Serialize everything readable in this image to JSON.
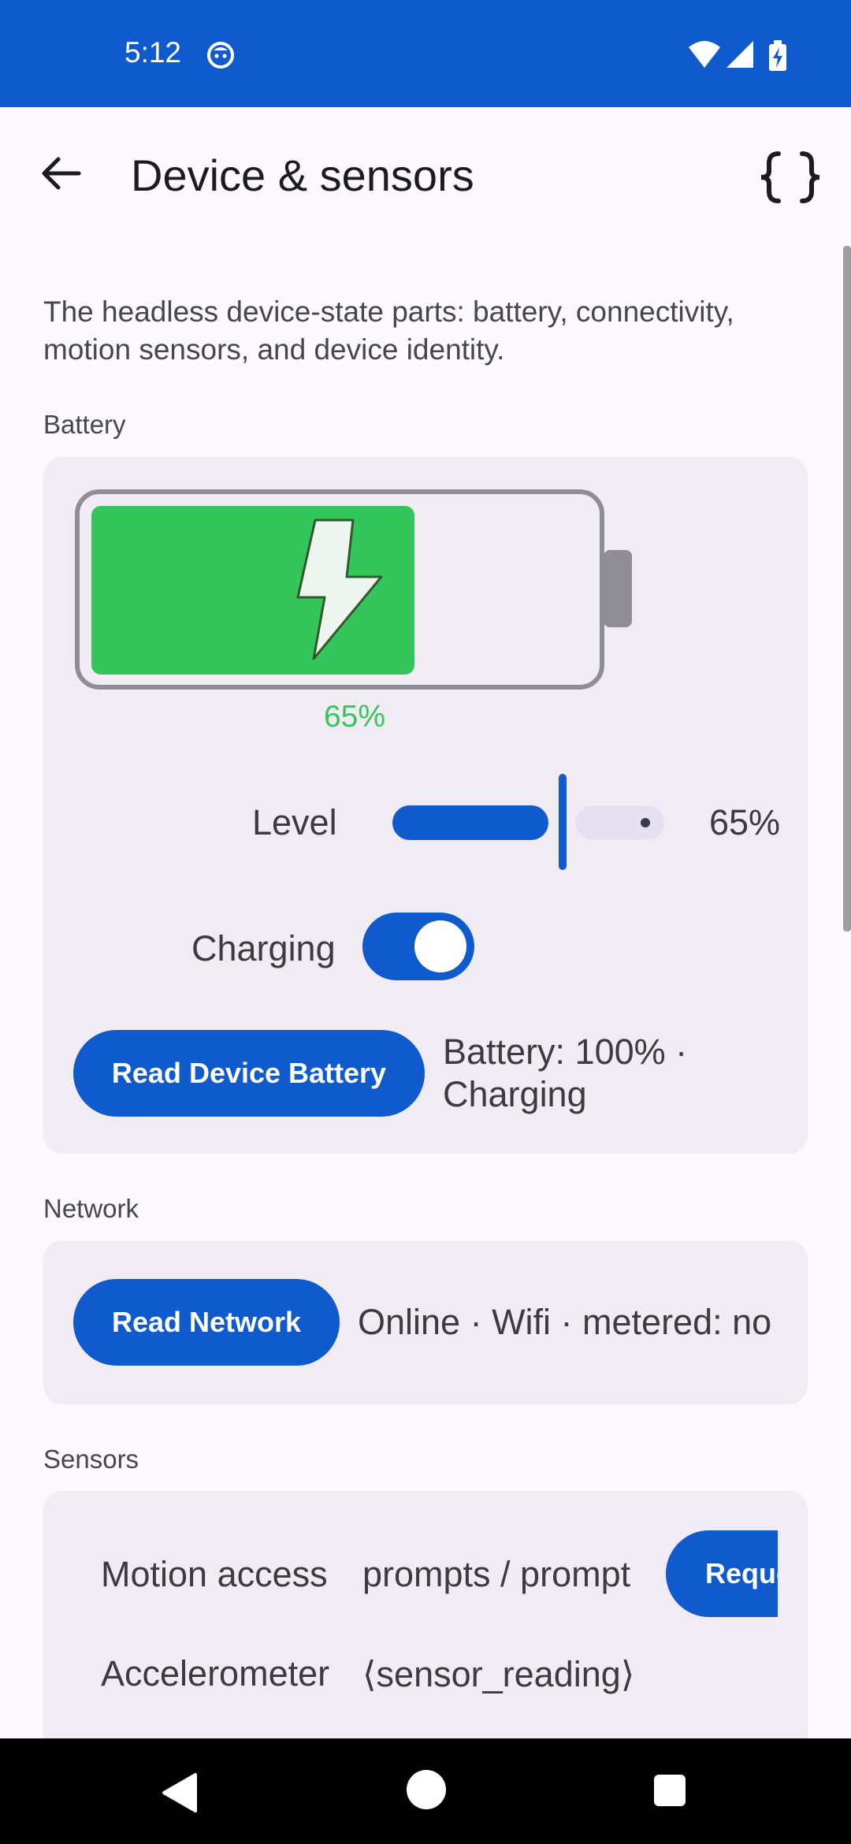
{
  "status_bar": {
    "time": "5:12"
  },
  "app_bar": {
    "title": "Device & sensors"
  },
  "description": "The headless device-state parts: battery, connectivity, motion sensors, and device identity.",
  "battery": {
    "section_label": "Battery",
    "level_percent": 65,
    "level_text": "65%",
    "level_label": "Level",
    "slider_value_text": "65%",
    "charging_label": "Charging",
    "charging_on": true,
    "read_button": "Read Device Battery",
    "result": "Battery: 100% · Charging",
    "fill_color": "#34c65a"
  },
  "network": {
    "section_label": "Network",
    "read_button": "Read Network",
    "result": "Online · Wifi · metered: no"
  },
  "sensors": {
    "section_label": "Sensors",
    "rows": [
      {
        "label": "Motion access",
        "value": "prompts / prompt",
        "button": "Request"
      },
      {
        "label": "Accelerometer",
        "value": "⟨sensor_reading⟩"
      }
    ]
  },
  "colors": {
    "accent": "#0f5acd",
    "background": "#fdf8fd",
    "card": "#f1ecf4"
  },
  "icons": {
    "status": [
      "notification-face-icon",
      "wifi-icon",
      "signal-icon",
      "battery-charging-icon"
    ],
    "app_bar": [
      "back-arrow-icon",
      "json-braces-icon"
    ],
    "nav": [
      "nav-back-icon",
      "nav-home-icon",
      "nav-recents-icon"
    ]
  }
}
